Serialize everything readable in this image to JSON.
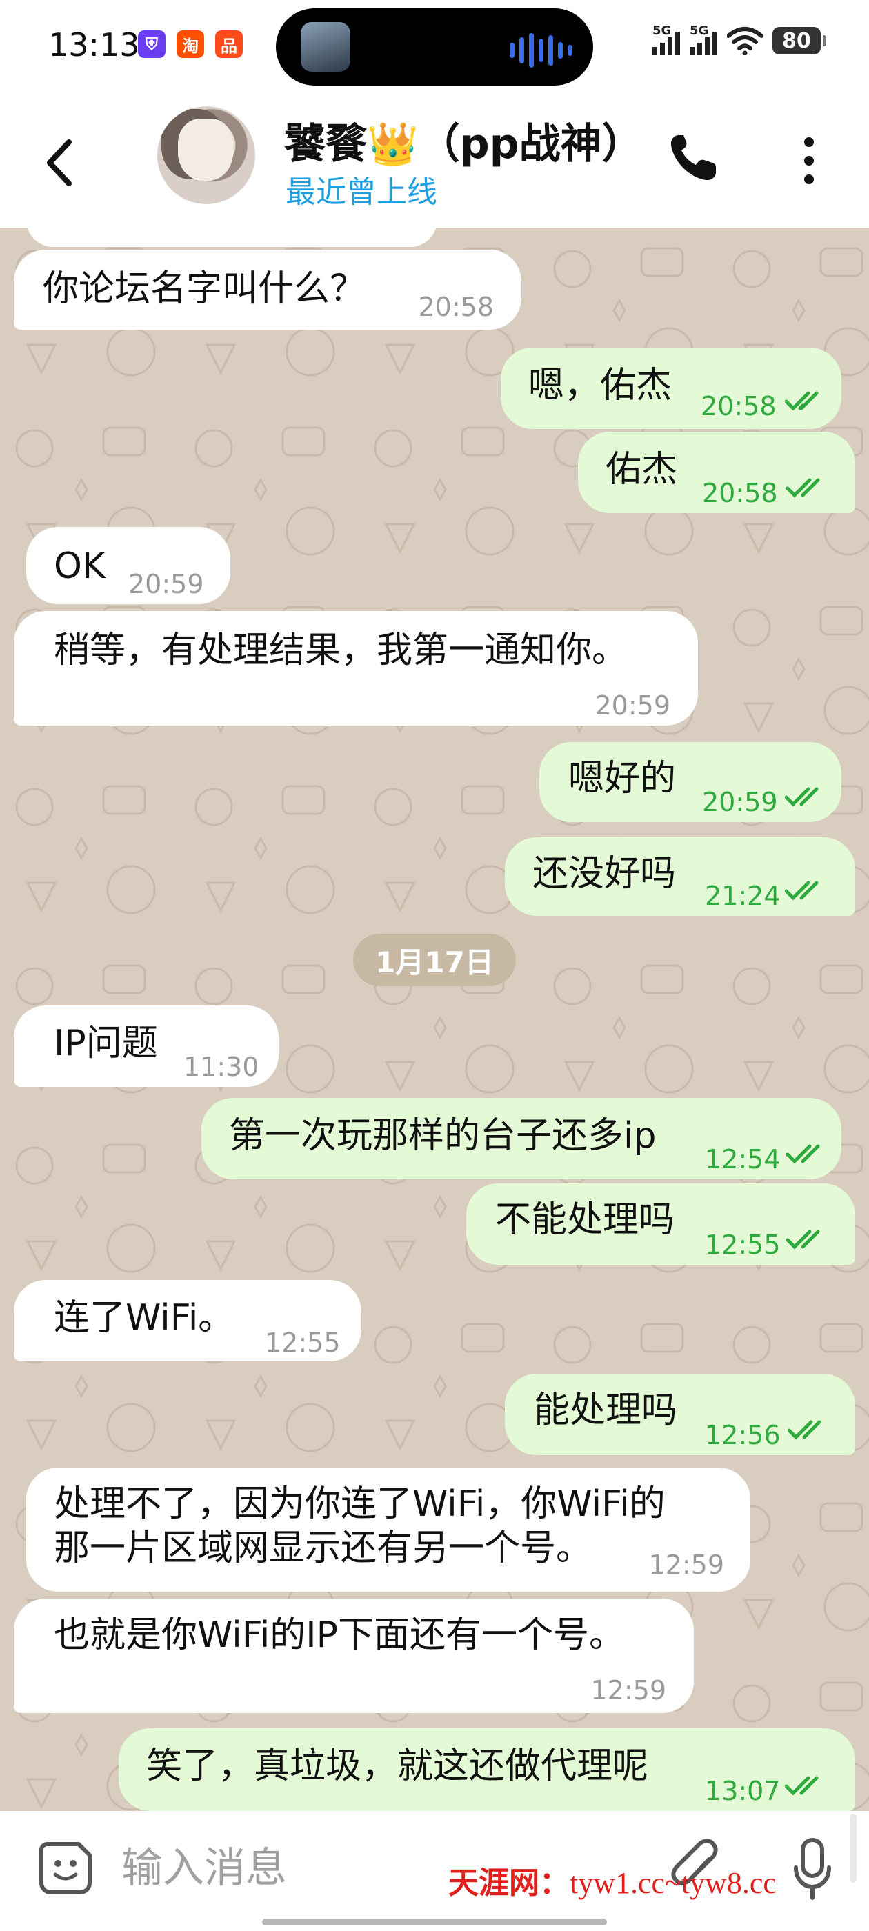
{
  "status_bar": {
    "time": "13:13",
    "apps": [
      {
        "name": "shield-app-icon",
        "label": "⛨",
        "color": "#6a3df0"
      },
      {
        "name": "taobao-app-icon",
        "label": "淘",
        "color": "#ff5000"
      },
      {
        "name": "orange-app-icon",
        "label": "品",
        "color": "#ff4a1a"
      }
    ],
    "signal_1": "5G",
    "signal_2": "5G",
    "battery": "80"
  },
  "header": {
    "contact_name": "饕餮👑（pp战神）",
    "status": "最近曾上线"
  },
  "chat": {
    "date_chip": "1月17日",
    "messages": [
      {
        "dir": "in",
        "text": "你论坛名字叫什么？",
        "time": "20:58"
      },
      {
        "dir": "out",
        "text": "嗯，佑杰",
        "time": "20:58"
      },
      {
        "dir": "out",
        "text": "佑杰",
        "time": "20:58"
      },
      {
        "dir": "in",
        "text": "OK",
        "time": "20:59"
      },
      {
        "dir": "in",
        "text": "稍等，有处理结果，我第一通知你。",
        "time": "20:59"
      },
      {
        "dir": "out",
        "text": "嗯好的",
        "time": "20:59"
      },
      {
        "dir": "out",
        "text": "还没好吗",
        "time": "21:24"
      },
      {
        "dir": "in",
        "text": "IP问题",
        "time": "11:30"
      },
      {
        "dir": "out",
        "text": "第一次玩那样的台子还多ip",
        "time": "12:54"
      },
      {
        "dir": "out",
        "text": "不能处理吗",
        "time": "12:55"
      },
      {
        "dir": "in",
        "text": "连了WiFi。",
        "time": "12:55"
      },
      {
        "dir": "out",
        "text": "能处理吗",
        "time": "12:56"
      },
      {
        "dir": "in",
        "text": "处理不了，因为你连了WiFi，你WiFi的",
        "text2": "那一片区域网显示还有另一个号。",
        "time": "12:59"
      },
      {
        "dir": "in",
        "text": "也就是你WiFi的IP下面还有一个号。",
        "time": "12:59"
      },
      {
        "dir": "out",
        "text": "笑了，真垃圾，就这还做代理呢",
        "time": "13:07"
      }
    ]
  },
  "input_bar": {
    "placeholder": "输入消息",
    "watermark_cn": "天涯网：",
    "watermark_url": "tyw1.cc~tyw8.cc"
  }
}
